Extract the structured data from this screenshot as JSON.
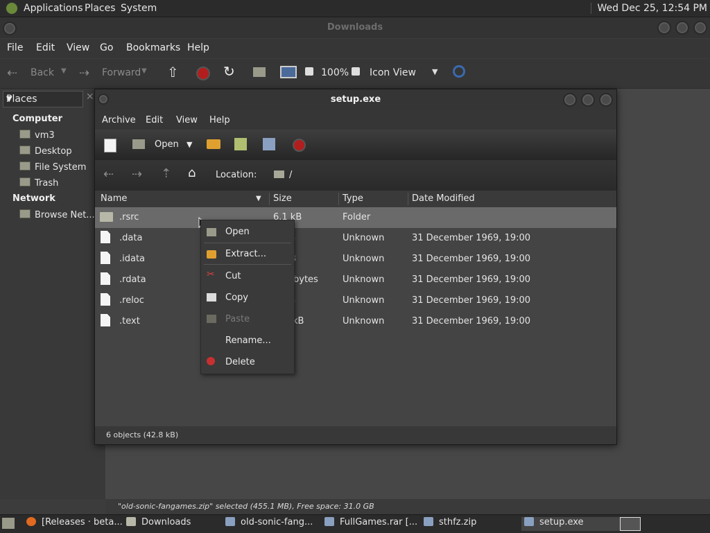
{
  "top_panel": {
    "menus": [
      "Applications",
      "Places",
      "System"
    ],
    "clock": "Wed Dec 25, 12:54 PM"
  },
  "window": {
    "title": "Downloads",
    "menubar": [
      "File",
      "Edit",
      "View",
      "Go",
      "Bookmarks",
      "Help"
    ],
    "toolbar": {
      "back": "Back",
      "forward": "Forward",
      "zoom": "100%",
      "view_mode": "Icon View"
    },
    "sidebar": {
      "selector": "Places",
      "sections": [
        {
          "title": "Computer",
          "items": [
            "vm3",
            "Desktop",
            "File System",
            "Trash"
          ]
        },
        {
          "title": "Network",
          "items": [
            "Browse Net..."
          ]
        }
      ]
    },
    "statusbar": "\"old-sonic-fangames.zip\" selected (455.1 MB), Free space: 31.0 GB"
  },
  "archive": {
    "title": "setup.exe",
    "menubar": [
      "Archive",
      "Edit",
      "View",
      "Help"
    ],
    "toolbar": {
      "open_label": "Open"
    },
    "location": {
      "label": "Location:",
      "path": "/"
    },
    "columns": [
      "Name",
      "Size",
      "Type",
      "Date Modified"
    ],
    "rows": [
      {
        "name": ".rsrc",
        "size": "6.1 kB",
        "type": "Folder",
        "date": "",
        "folder": true
      },
      {
        "name": ".data",
        "size": "3",
        "type": "Unknown",
        "date": "31 December 1969, 19:00"
      },
      {
        "name": ".idata",
        "size": "B",
        "type": "Unknown",
        "date": "31 December 1969, 19:00"
      },
      {
        "name": ".rdata",
        "size": "bytes",
        "type": "Unknown",
        "date": "31 December 1969, 19:00"
      },
      {
        "name": ".reloc",
        "size": "3",
        "type": "Unknown",
        "date": "31 December 1969, 19:00"
      },
      {
        "name": ".text",
        "size": "kB",
        "type": "Unknown",
        "date": "31 December 1969, 19:00"
      }
    ],
    "status": "6 objects (42.8 kB)"
  },
  "context_menu": {
    "items": [
      "Open",
      "Extract...",
      "Cut",
      "Copy",
      "Paste",
      "Rename...",
      "Delete"
    ]
  },
  "taskbar": {
    "tasks": [
      "[Releases · beta...",
      "Downloads",
      "old-sonic-fang...",
      "FullGames.rar [...",
      "sthfz.zip",
      "setup.exe"
    ]
  }
}
